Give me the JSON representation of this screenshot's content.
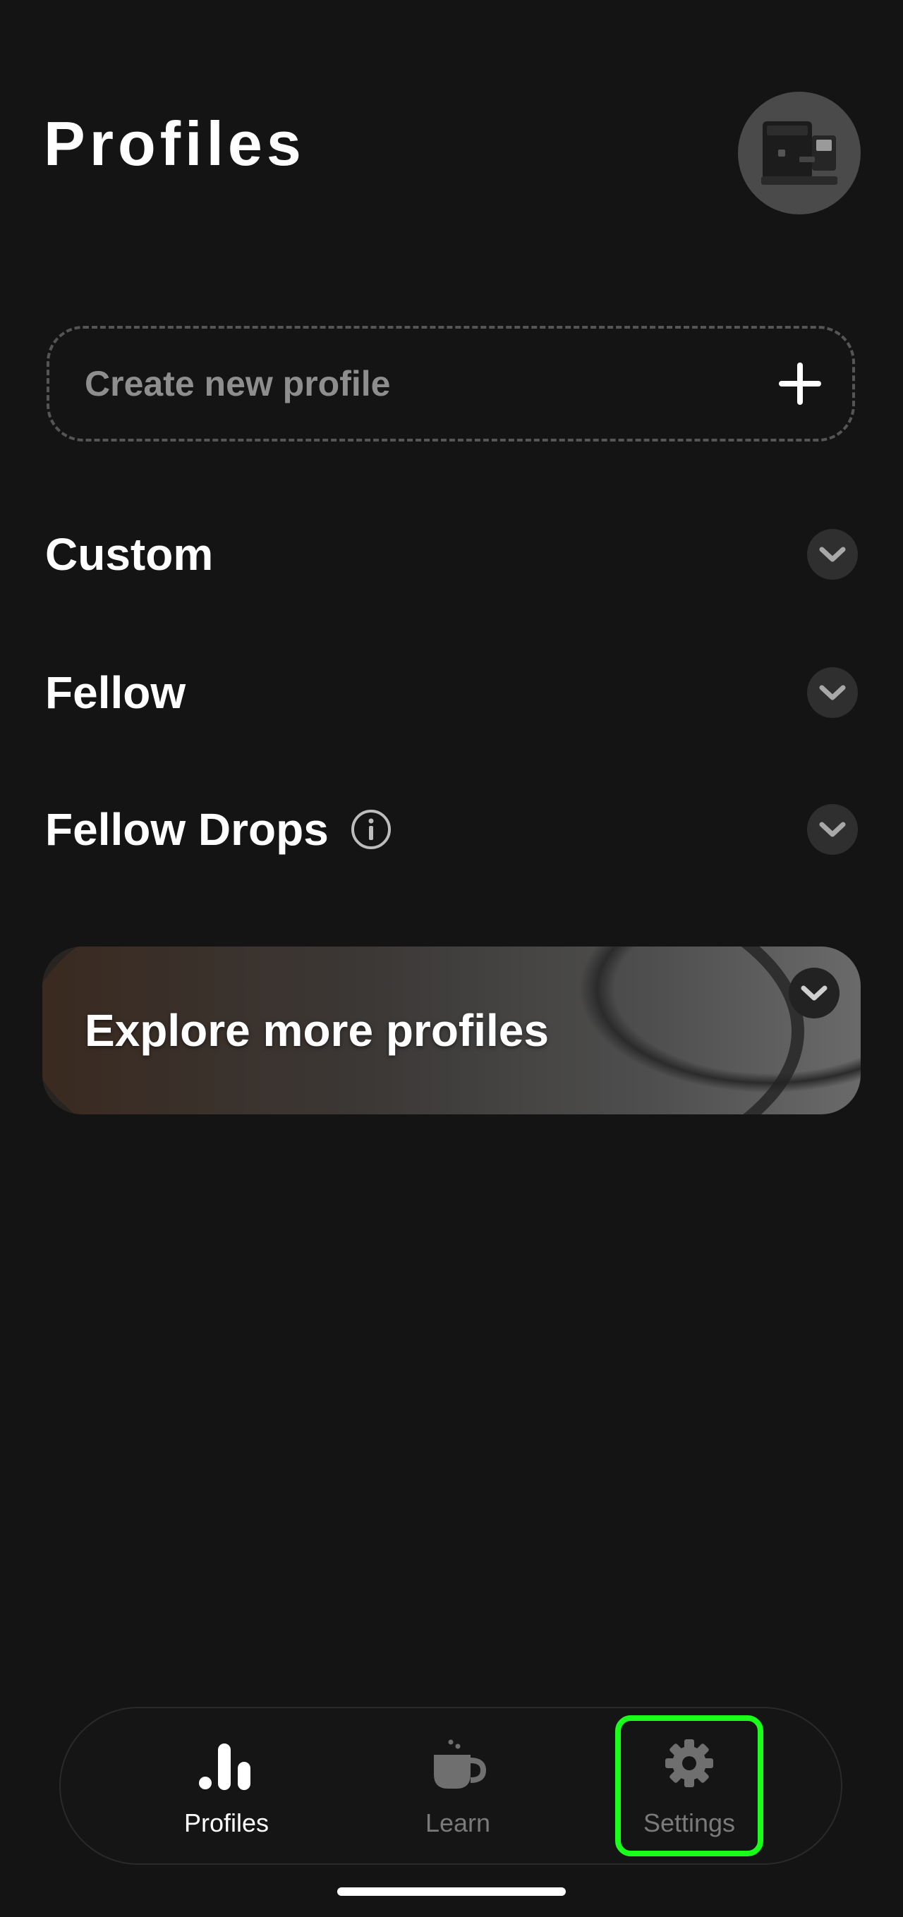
{
  "header": {
    "title": "Profiles",
    "avatar_icon": "espresso-machine-icon"
  },
  "create_profile": {
    "label": "Create new profile",
    "icon": "plus-icon"
  },
  "sections": [
    {
      "title": "Custom",
      "icon": "chevron-down-icon"
    },
    {
      "title": "Fellow",
      "icon": "chevron-down-icon"
    },
    {
      "title": "Fellow Drops",
      "info_icon": "info-icon",
      "icon": "chevron-down-icon"
    }
  ],
  "explore": {
    "label": "Explore more profiles",
    "icon": "chevron-down-icon"
  },
  "tab_bar": {
    "tabs": [
      {
        "label": "Profiles",
        "icon": "bar-chart-icon",
        "state": "active"
      },
      {
        "label": "Learn",
        "icon": "coffee-cup-icon",
        "state": "inactive"
      },
      {
        "label": "Settings",
        "icon": "gear-icon",
        "state": "inactive"
      }
    ]
  },
  "colors": {
    "background": "#141414",
    "highlight": "#1aff1a",
    "muted_text": "#8e8e8e"
  }
}
